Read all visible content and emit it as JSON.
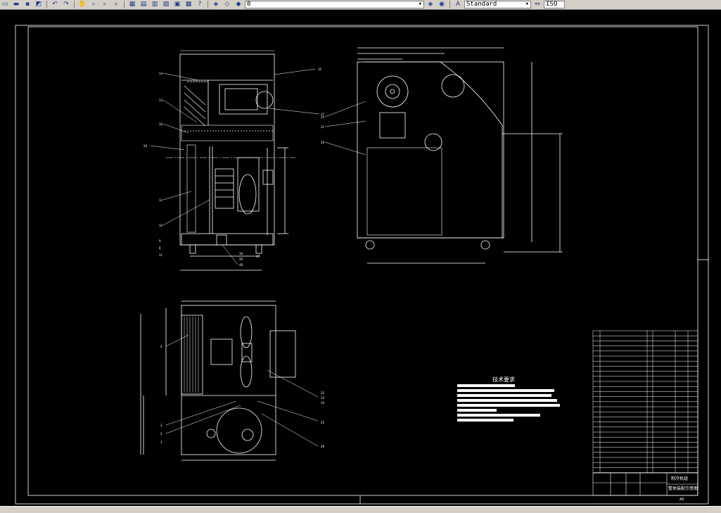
{
  "toolbar": {
    "icons": [
      "new-icon",
      "open-icon",
      "save-icon",
      "plot-icon",
      "match-properties-icon",
      "undo-icon",
      "redo-icon",
      "pan-icon",
      "zoom-realtime-icon",
      "zoom-window-icon",
      "zoom-previous-icon",
      "properties-icon",
      "design-center-icon",
      "tool-palettes-icon",
      "sheet-set-icon",
      "markup-icon",
      "calculator-icon",
      "help-icon",
      "layer-manager-icon",
      "layer-state-icon",
      "layer-previous-icon"
    ],
    "layer_value": "0",
    "text_style_value": "Standard",
    "dim_style_value": "ISO"
  },
  "drawing": {
    "tech_requirements_title": "技术要求",
    "title_block": {
      "line1": "制冷机组",
      "line2": "整体装配示意图",
      "scale": "A0"
    },
    "leaders_front": [
      "14",
      "15",
      "13",
      "16",
      "50",
      "17",
      "12",
      "10",
      "9",
      "8",
      "11",
      "18",
      "29",
      "48",
      "47",
      "46",
      "45",
      "44",
      "43",
      "42"
    ],
    "leaders_side": [
      "28",
      "22",
      "21",
      "20",
      "19",
      "17"
    ],
    "leaders_plan": [
      "4",
      "3",
      "2",
      "1",
      "22",
      "23",
      "24",
      "25",
      "26"
    ]
  },
  "colors": {
    "background": "#000000",
    "line": "#ffffff",
    "toolbar": "#d4d0c8"
  }
}
